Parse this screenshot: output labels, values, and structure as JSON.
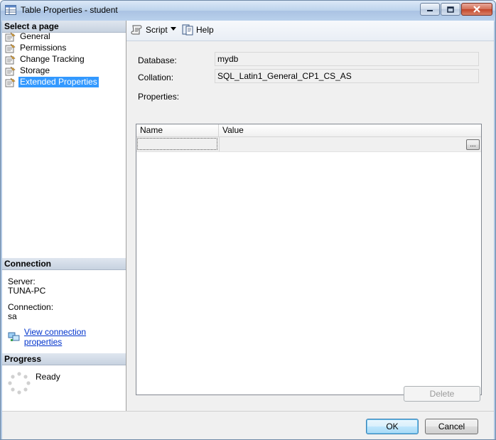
{
  "window": {
    "title": "Table Properties - student"
  },
  "left": {
    "select_page_header": "Select a page",
    "pages": [
      {
        "label": "General"
      },
      {
        "label": "Permissions"
      },
      {
        "label": "Change Tracking"
      },
      {
        "label": "Storage"
      },
      {
        "label": "Extended Properties",
        "selected": true
      }
    ],
    "connection": {
      "header": "Connection",
      "server_label": "Server:",
      "server_value": "TUNA-PC",
      "connection_label": "Connection:",
      "connection_value": "sa",
      "view_link": "View connection properties"
    },
    "progress": {
      "header": "Progress",
      "status": "Ready"
    }
  },
  "toolbar": {
    "script_label": "Script",
    "help_label": "Help"
  },
  "form": {
    "database_label": "Database:",
    "database_value": "mydb",
    "collation_label": "Collation:",
    "collation_value": "SQL_Latin1_General_CP1_CS_AS",
    "properties_label": "Properties:",
    "columns": [
      "Name",
      "Value"
    ],
    "ellipsis_label": "...",
    "delete_label": "Delete"
  },
  "buttons": {
    "ok_label": "OK",
    "cancel_label": "Cancel"
  }
}
